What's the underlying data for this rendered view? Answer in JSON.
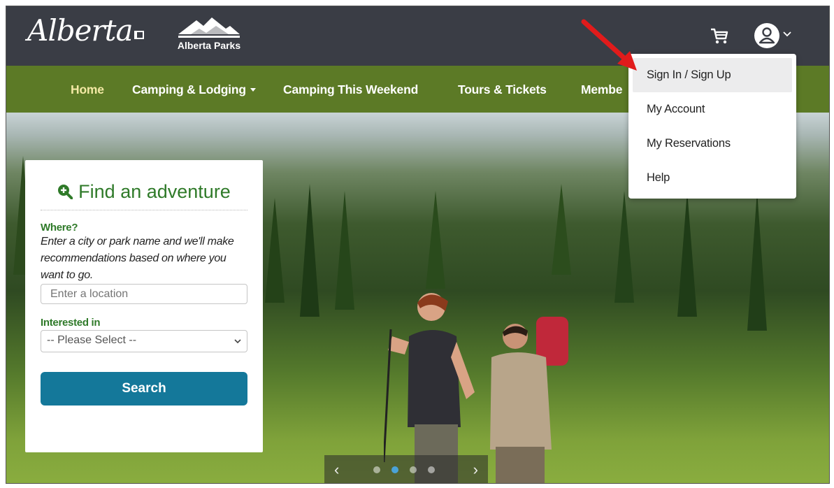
{
  "header": {
    "brand": "Alberta",
    "parks_label": "Alberta Parks"
  },
  "nav": {
    "items": [
      {
        "label": "Home",
        "active": true
      },
      {
        "label": "Camping & Lodging",
        "has_caret": true
      },
      {
        "label": "Camping This Weekend"
      },
      {
        "label": "Tours & Tickets"
      },
      {
        "label": "Membe"
      }
    ]
  },
  "search": {
    "title": "Find an adventure",
    "where_label": "Where?",
    "where_hint": "Enter a city or park name and we'll make recommendations based on where you want to go.",
    "location_placeholder": "Enter a location",
    "interested_label": "Interested in",
    "interested_value": "-- Please Select --",
    "button_label": "Search"
  },
  "carousel": {
    "prev": "‹",
    "next": "›"
  },
  "account_menu": {
    "items": [
      {
        "label": "Sign In / Sign Up",
        "highlighted": true
      },
      {
        "label": "My Account"
      },
      {
        "label": "My Reservations"
      },
      {
        "label": "Help"
      }
    ]
  },
  "colors": {
    "header_bg": "#3a3d45",
    "nav_bg": "#5c7a26",
    "nav_active": "#f3e9a5",
    "brand_green": "#2f7a29",
    "button_bg": "#14789a",
    "annotation_arrow": "#e11b1b"
  },
  "icons": [
    "cart-icon",
    "user-icon",
    "chevron-down-icon",
    "search-plus-icon",
    "mountain-logo-icon"
  ]
}
